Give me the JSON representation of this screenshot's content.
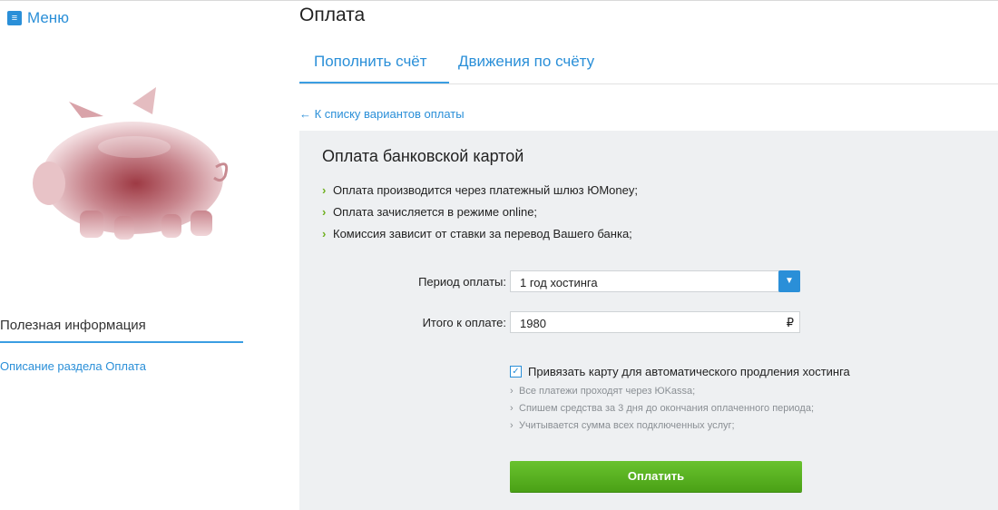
{
  "sidebar": {
    "menu_label": "Меню",
    "info_title": "Полезная информация",
    "info_link": "Описание раздела Оплата"
  },
  "header": {
    "title": "Оплата",
    "tabs": [
      {
        "label": "Пополнить счёт",
        "active": true
      },
      {
        "label": "Движения по счёту",
        "active": false
      }
    ],
    "back_link": "← К списку вариантов оплаты"
  },
  "panel": {
    "title": "Оплата банковской картой",
    "bullets": [
      "Оплата производится через платежный шлюз ЮMoney;",
      "Оплата зачисляется в режиме online;",
      "Комиссия зависит от ставки за перевод Вашего банка;"
    ],
    "period_label": "Период оплаты:",
    "period_value": "1 год хостинга",
    "total_label": "Итого к оплате:",
    "total_value": "1980",
    "currency": "₽",
    "autorenew_label": "Привязать карту для автоматического продления хостинга",
    "autorenew_checked": true,
    "autorenew_notes": [
      "Все платежи проходят через ЮKassa;",
      "Спишем средства за 3 дня до окончания оплаченного периода;",
      "Учитывается сумма всех подключенных услуг;"
    ],
    "pay_button": "Оплатить"
  },
  "icons": {
    "menu": "menu-icon",
    "select_arrow": "chevron-down-icon",
    "bullet": "chevron-right-icon",
    "checkbox": "checkmark-icon",
    "illustration": "piggy-bank-image"
  },
  "colors": {
    "accent": "#2a8fd8",
    "panel_bg": "#eef0f2",
    "bullet_green": "#6fb020",
    "button_green": "#5ab321"
  }
}
